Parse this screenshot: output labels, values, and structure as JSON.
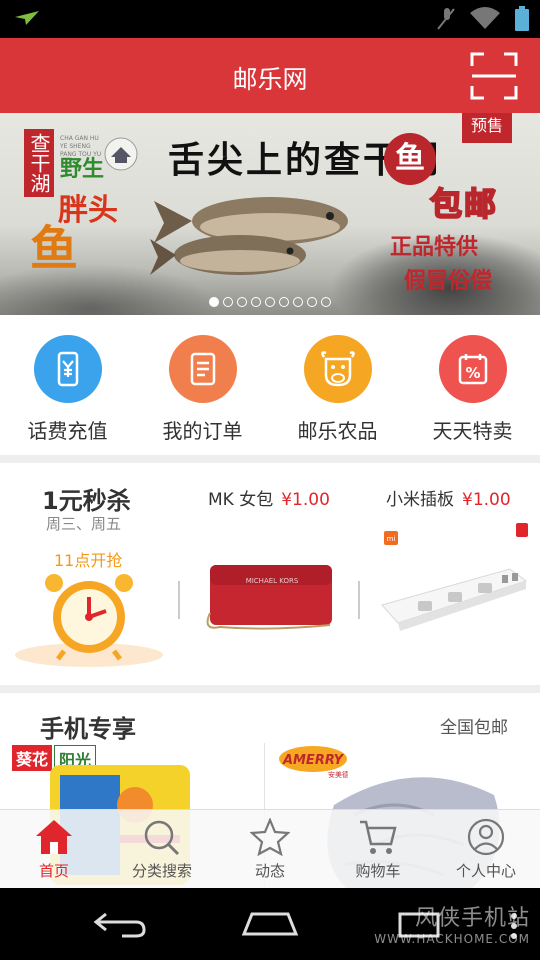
{
  "header": {
    "title": "邮乐网"
  },
  "banner": {
    "left_vertical": "查干湖",
    "wild": "野生",
    "fat_head": "胖头",
    "fish": "鱼",
    "slogan": "舌尖上的查干湖",
    "seal": "鱼",
    "free_shipping": "包邮",
    "genuine": "正品特供",
    "refund": "假冒俗偿",
    "presale": "预售",
    "pinyin": "CHA GAN HU YE SHENG PANG TOU YU",
    "slide_count": 9,
    "active_slide": 0
  },
  "quicknav": [
    {
      "label": "话费充值",
      "icon": "yuan-phone-icon",
      "color": "#3ba3ec"
    },
    {
      "label": "我的订单",
      "icon": "order-list-icon",
      "color": "#f07f4d"
    },
    {
      "label": "邮乐农品",
      "icon": "cow-icon",
      "color": "#f5a623"
    },
    {
      "label": "天天特卖",
      "icon": "discount-calendar-icon",
      "color": "#ef5350"
    }
  ],
  "flash_sale": {
    "title": "1元秒杀",
    "days": "周三、周五",
    "start": "11点开抢",
    "products": [
      {
        "name": "MK 女包",
        "price": "¥1.00",
        "brand": "MICHAEL KORS"
      },
      {
        "name": "小米插板",
        "price": "¥1.00",
        "brand": "mi"
      }
    ]
  },
  "mobile_exclusive": {
    "title": "手机专享",
    "right_label": "全国包邮",
    "items": [
      {
        "brand_a": "葵花",
        "brand_b": "阳光"
      },
      {
        "brand": "AMERRY",
        "brand_cn": "安美德"
      }
    ]
  },
  "tabbar": [
    {
      "label": "首页",
      "icon": "home-icon",
      "active": true
    },
    {
      "label": "分类搜索",
      "icon": "search-icon",
      "active": false
    },
    {
      "label": "动态",
      "icon": "star-icon",
      "active": false
    },
    {
      "label": "购物车",
      "icon": "cart-icon",
      "active": false
    },
    {
      "label": "个人中心",
      "icon": "user-icon",
      "active": false
    }
  ],
  "watermark": {
    "line1": "风侠手机站",
    "line2": "WWW.HACKHOME.COM"
  },
  "colors": {
    "brand_red": "#d9363a",
    "price_red": "#e0262c",
    "accent_orange": "#f39a1a"
  }
}
